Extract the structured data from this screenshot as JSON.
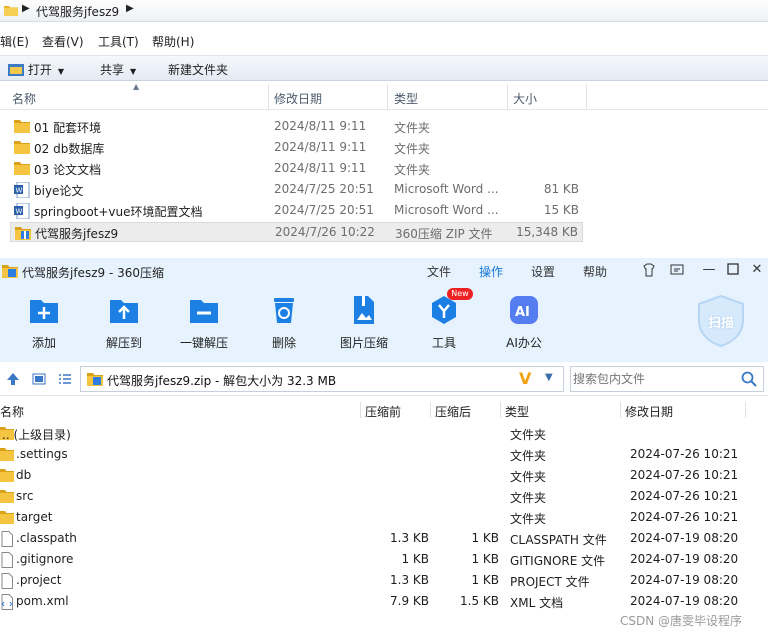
{
  "explorer": {
    "breadcrumb": "代驾服务jfesz9",
    "menu": [
      "辑(E)",
      "查看(V)",
      "工具(T)",
      "帮助(H)"
    ],
    "commands": {
      "open": "打开",
      "share": "共享",
      "new_folder": "新建文件夹"
    },
    "columns": {
      "name": "名称",
      "date": "修改日期",
      "type": "类型",
      "size": "大小"
    },
    "rows": [
      {
        "name": "01 配套环境",
        "date": "2024/8/11 9:11",
        "type": "文件夹",
        "size": "",
        "icon": "folder-icon"
      },
      {
        "name": "02 db数据库",
        "date": "2024/8/11 9:11",
        "type": "文件夹",
        "size": "",
        "icon": "folder-icon"
      },
      {
        "name": "03 论文文档",
        "date": "2024/8/11 9:11",
        "type": "文件夹",
        "size": "",
        "icon": "folder-icon"
      },
      {
        "name": "biye论文",
        "date": "2024/7/25 20:51",
        "type": "Microsoft Word ...",
        "size": "81 KB",
        "icon": "word-doc-icon"
      },
      {
        "name": "springboot+vue环境配置文档",
        "date": "2024/7/25 20:51",
        "type": "Microsoft Word ...",
        "size": "15 KB",
        "icon": "word-doc-icon"
      },
      {
        "name": "代驾服务jfesz9",
        "date": "2024/7/26 10:22",
        "type": "360压缩 ZIP 文件",
        "size": "15,348 KB",
        "icon": "zip-archive-icon"
      }
    ]
  },
  "zip": {
    "title": "代驾服务jfesz9 - 360压缩",
    "tabs": [
      "文件",
      "操作",
      "设置",
      "帮助"
    ],
    "active_tab": "操作",
    "tools": [
      {
        "label": "添加",
        "icon": "add-icon"
      },
      {
        "label": "解压到",
        "icon": "extract-to-icon"
      },
      {
        "label": "一键解压",
        "icon": "one-click-extract-icon"
      },
      {
        "label": "删除",
        "icon": "delete-icon"
      },
      {
        "label": "图片压缩",
        "icon": "image-compress-icon"
      },
      {
        "label": "工具",
        "icon": "tools-icon"
      },
      {
        "label": "AI办公",
        "icon": "ai-office-icon"
      }
    ],
    "new_badge": "New",
    "ai_glyph": "AI",
    "scan_label": "扫描",
    "path": "代驾服务jfesz9.zip - 解包大小为 32.3 MB",
    "search_placeholder": "搜索包内文件",
    "columns": {
      "name": "名称",
      "compressed": "压缩前",
      "packed": "压缩后",
      "type": "类型",
      "date": "修改日期"
    },
    "rows": [
      {
        "name": ".. (上级目录)",
        "compressed": "",
        "packed": "",
        "type": "文件夹",
        "date": "",
        "icon": "folder-icon"
      },
      {
        "name": ".settings",
        "compressed": "",
        "packed": "",
        "type": "文件夹",
        "date": "2024-07-26 10:21",
        "icon": "folder-icon"
      },
      {
        "name": "db",
        "compressed": "",
        "packed": "",
        "type": "文件夹",
        "date": "2024-07-26 10:21",
        "icon": "folder-icon"
      },
      {
        "name": "src",
        "compressed": "",
        "packed": "",
        "type": "文件夹",
        "date": "2024-07-26 10:21",
        "icon": "folder-icon"
      },
      {
        "name": "target",
        "compressed": "",
        "packed": "",
        "type": "文件夹",
        "date": "2024-07-26 10:21",
        "icon": "folder-icon"
      },
      {
        "name": ".classpath",
        "compressed": "1.3 KB",
        "packed": "1 KB",
        "type": "CLASSPATH 文件",
        "date": "2024-07-19 08:20",
        "icon": "file-icon"
      },
      {
        "name": ".gitignore",
        "compressed": "1 KB",
        "packed": "1 KB",
        "type": "GITIGNORE 文件",
        "date": "2024-07-19 08:20",
        "icon": "file-icon"
      },
      {
        "name": ".project",
        "compressed": "1.3 KB",
        "packed": "1 KB",
        "type": "PROJECT 文件",
        "date": "2024-07-19 08:20",
        "icon": "file-icon"
      },
      {
        "name": "pom.xml",
        "compressed": "7.9 KB",
        "packed": "1.5 KB",
        "type": "XML 文档",
        "date": "2024-07-19 08:20",
        "icon": "xml-file-icon"
      }
    ]
  },
  "watermark": "CSDN @唐雯毕设程序",
  "colors": {
    "accent": "#1677d9",
    "folder": "#e8b420",
    "toolbar_bg": "#e6f3ff"
  }
}
